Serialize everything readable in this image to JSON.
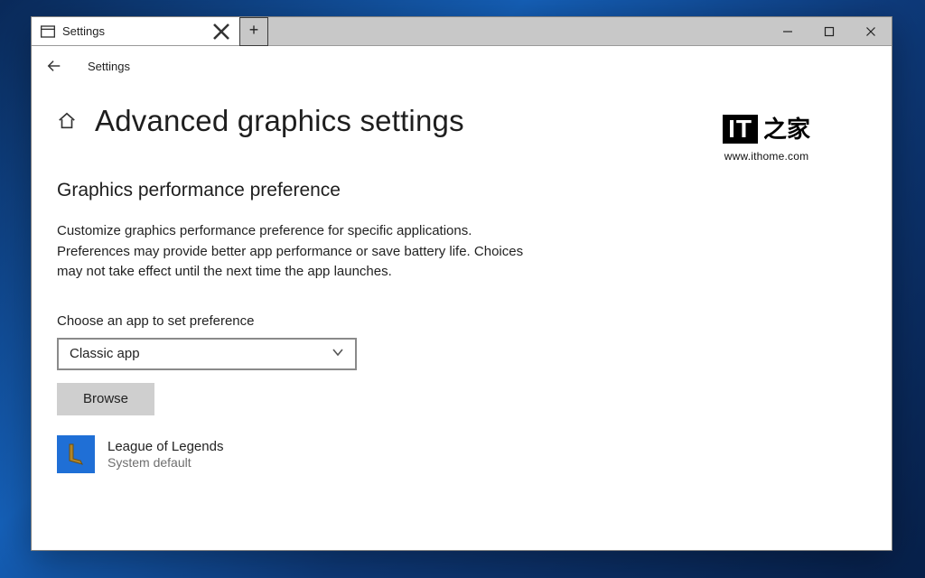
{
  "tab": {
    "title": "Settings"
  },
  "breadcrumb": "Settings",
  "page": {
    "title": "Advanced graphics settings",
    "section_heading": "Graphics performance preference",
    "description": "Customize graphics performance preference for specific applications. Preferences may provide better app performance or save battery life. Choices may not take effect until the next time the app launches.",
    "choose_label": "Choose an app to set preference",
    "app_type_selected": "Classic app",
    "browse_label": "Browse"
  },
  "apps": [
    {
      "name": "League of Legends",
      "preference": "System default"
    }
  ],
  "watermark": {
    "brand_it": "IT",
    "brand_zh": "之家",
    "url": "www.ithome.com"
  }
}
